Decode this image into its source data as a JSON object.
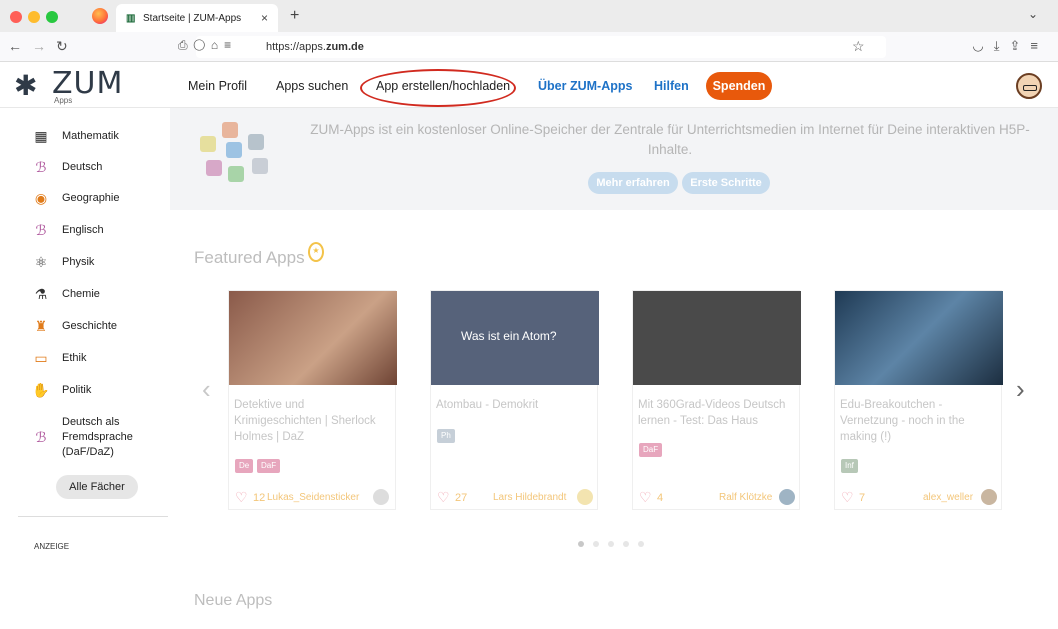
{
  "browser": {
    "tab_title": "Startseite | ZUM-Apps",
    "url_prefix": "https://apps.",
    "url_domain": "zum.de",
    "new_tab": "+",
    "close": "×"
  },
  "header": {
    "logo_text": "ZUM",
    "logo_sub": "Apps",
    "nav": [
      "Mein Profil",
      "Apps suchen",
      "App erstellen/hochladen",
      "Über ZUM-Apps",
      "Hilfen"
    ],
    "donate": "Spenden"
  },
  "sidebar": {
    "subjects": [
      {
        "label": "Mathematik",
        "icon": "calculator-icon"
      },
      {
        "label": "Deutsch",
        "icon": "speech-bubble-icon"
      },
      {
        "label": "Geographie",
        "icon": "globe-icon"
      },
      {
        "label": "Englisch",
        "icon": "speech-bubble-icon"
      },
      {
        "label": "Physik",
        "icon": "atom-icon"
      },
      {
        "label": "Chemie",
        "icon": "flask-icon"
      },
      {
        "label": "Geschichte",
        "icon": "ruin-icon"
      },
      {
        "label": "Ethik",
        "icon": "book-icon"
      },
      {
        "label": "Politik",
        "icon": "handshake-icon"
      },
      {
        "label": "Deutsch als Fremdsprache (DaF/DaZ)",
        "icon": "speech-bubble-icon"
      }
    ],
    "all_subjects": "Alle Fächer",
    "ad_label": "ANZEIGE"
  },
  "banner": {
    "text": "ZUM-Apps ist ein kostenloser Online-Speicher der Zentrale für Unterrichtsmedien im Internet für Deine interaktiven H5P-Inhalte.",
    "more": "Mehr erfahren",
    "first_steps": "Erste Schritte"
  },
  "featured": {
    "heading": "Featured Apps",
    "cards": [
      {
        "title": "Detektive und Krimigeschichten | Sherlock Holmes | DaZ",
        "tags": [
          "De",
          "DaF"
        ],
        "likes": "12",
        "author": "Lukas_Seidensticker"
      },
      {
        "title": "Atombau - Demokrit",
        "tags": [
          "Ph"
        ],
        "likes": "27",
        "author": "Lars Hildebrandt",
        "image_text": "Was ist ein Atom?"
      },
      {
        "title": "Mit 360Grad-Videos Deutsch lernen - Test: Das Haus",
        "tags": [
          "DaF"
        ],
        "likes": "4",
        "author": "Ralf Klötzke"
      },
      {
        "title": "Edu-Breakoutchen - Vernetzung - noch in the making (!)",
        "tags": [
          "Inf"
        ],
        "likes": "7",
        "author": "alex_weller"
      }
    ]
  },
  "neue": {
    "heading": "Neue Apps"
  }
}
